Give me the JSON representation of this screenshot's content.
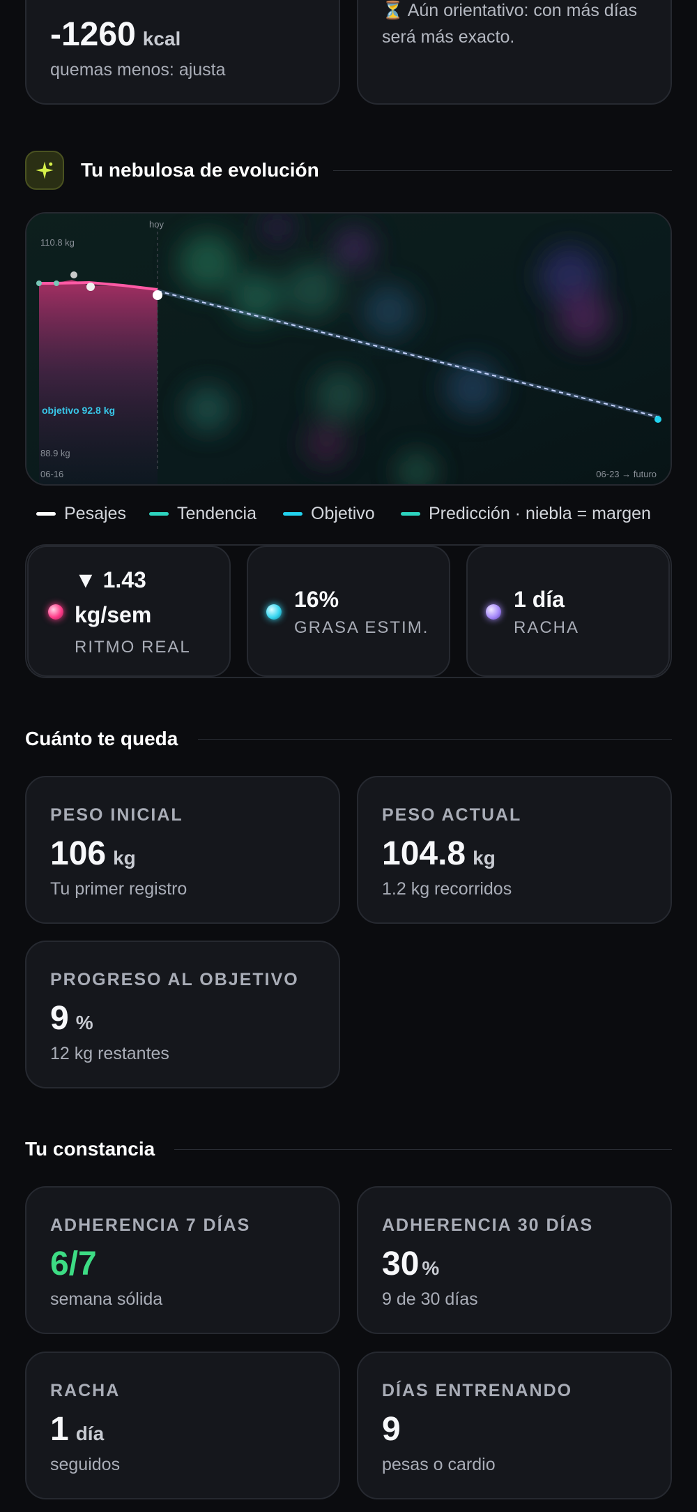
{
  "top_cards": {
    "left": {
      "value": "-1260",
      "unit": "kcal",
      "sub": "quemas menos: ajusta"
    },
    "right": {
      "icon": "hourglass-icon",
      "line1": "Aún orientativo: con más días",
      "line2": "será más exacto."
    }
  },
  "nebula": {
    "icon": "sparkle-icon",
    "title": "Tu nebulosa de evolución",
    "chart": {
      "today_label": "hoy",
      "y_top_label": "110.8 kg",
      "y_bottom_label": "88.9 kg",
      "goal_label": "objetivo 92.8 kg",
      "x_start_label": "06-16",
      "x_end_label": "06-23 → futuro"
    },
    "legend": [
      {
        "label": "Pesajes",
        "color": "#ffffff"
      },
      {
        "label": "Tendencia",
        "color": "#2dd4bf"
      },
      {
        "label": "Objetivo",
        "color": "#22d3ee"
      },
      {
        "label": "Predicción · niebla = margen",
        "color": "#2dd4bf"
      }
    ],
    "stats": [
      {
        "value_line1": "▼ 1.43",
        "value_line2": "kg/sem",
        "label": "RITMO REAL",
        "orb_color": "#ff3d8a"
      },
      {
        "value": "16%",
        "label": "GRASA ESTIM.",
        "orb_color": "#38d6f0"
      },
      {
        "value": "1 día",
        "label": "RACHA",
        "orb_color": "#a78bfa"
      }
    ]
  },
  "remaining": {
    "title": "Cuánto te queda",
    "cards": [
      {
        "label": "PESO INICIAL",
        "value": "106",
        "unit": "kg",
        "sub": "Tu primer registro"
      },
      {
        "label": "PESO ACTUAL",
        "value": "104.8",
        "unit": "kg",
        "sub": "1.2 kg recorridos"
      },
      {
        "label": "PROGRESO AL OBJETIVO",
        "value": "9",
        "unit": "%",
        "sub": "12 kg restantes"
      }
    ]
  },
  "consistency": {
    "title": "Tu constancia",
    "cards": [
      {
        "label": "ADHERENCIA 7 DÍAS",
        "value": "6/7",
        "unit": "",
        "sub": "semana sólida",
        "value_color": "#3ddc84"
      },
      {
        "label": "ADHERENCIA 30 DÍAS",
        "value": "30",
        "unit": "%",
        "sub": "9 de 30 días"
      },
      {
        "label": "RACHA",
        "value": "1",
        "unit": "día",
        "sub": "seguidos"
      },
      {
        "label": "DÍAS ENTRENANDO",
        "value": "9",
        "unit": "",
        "sub": "pesas o cardio"
      }
    ]
  }
}
